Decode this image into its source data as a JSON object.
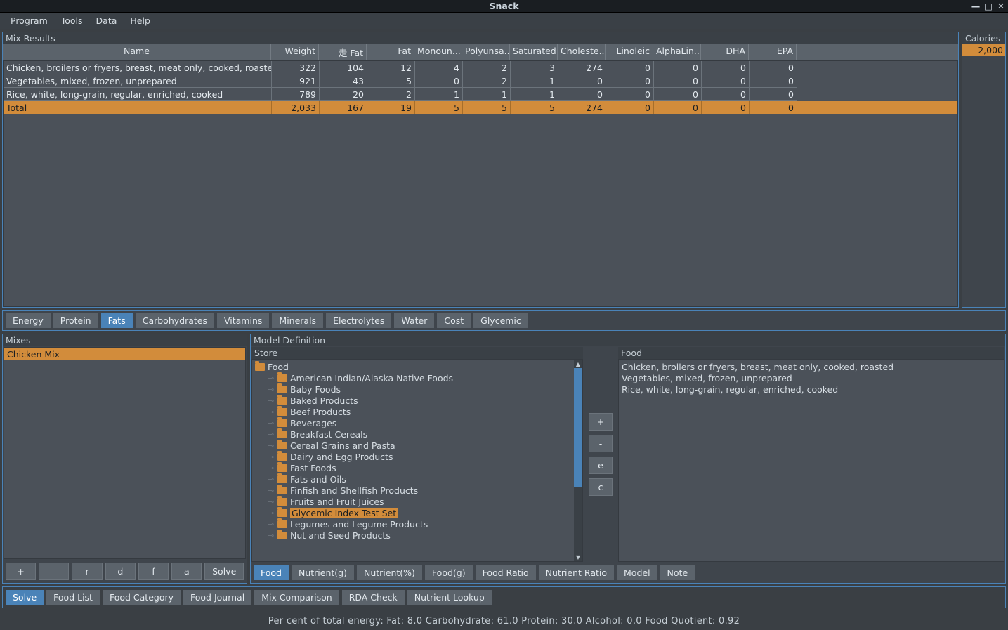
{
  "window": {
    "title": "Snack"
  },
  "menubar": {
    "items": [
      "Program",
      "Tools",
      "Data",
      "Help"
    ]
  },
  "calories": {
    "label": "Calories",
    "value": "2,000"
  },
  "mix_results": {
    "label": "Mix Results",
    "columns": [
      "Name",
      "Weight",
      "走 Fat",
      "Fat",
      "Monoun...",
      "Polyunsa...",
      "Saturated",
      "Choleste...",
      "Linoleic",
      "AlphaLin...",
      "DHA",
      "EPA"
    ],
    "rows": [
      {
        "name": "Chicken, broilers or fryers, breast, meat only, cooked, roasted",
        "vals": [
          "322",
          "104",
          "12",
          "4",
          "2",
          "3",
          "274",
          "0",
          "0",
          "0",
          "0"
        ]
      },
      {
        "name": "Vegetables, mixed, frozen, unprepared",
        "vals": [
          "921",
          "43",
          "5",
          "0",
          "2",
          "1",
          "0",
          "0",
          "0",
          "0",
          "0"
        ]
      },
      {
        "name": "Rice, white, long-grain, regular, enriched, cooked",
        "vals": [
          "789",
          "20",
          "2",
          "1",
          "1",
          "1",
          "0",
          "0",
          "0",
          "0",
          "0"
        ]
      }
    ],
    "total": {
      "name": "Total",
      "vals": [
        "2,033",
        "167",
        "19",
        "5",
        "5",
        "5",
        "274",
        "0",
        "0",
        "0",
        "0"
      ]
    }
  },
  "nutrient_tabs": {
    "items": [
      "Energy",
      "Protein",
      "Fats",
      "Carbohydrates",
      "Vitamins",
      "Minerals",
      "Electrolytes",
      "Water",
      "Cost",
      "Glycemic"
    ],
    "active": 2
  },
  "mixes": {
    "label": "Mixes",
    "items": [
      "Chicken Mix"
    ],
    "buttons": [
      "+",
      "-",
      "r",
      "d",
      "f",
      "a",
      "Solve"
    ]
  },
  "model_def": {
    "label": "Model Definition"
  },
  "store": {
    "label": "Store",
    "root": "Food",
    "children": [
      "American Indian/Alaska Native Foods",
      "Baby Foods",
      "Baked Products",
      "Beef Products",
      "Beverages",
      "Breakfast Cereals",
      "Cereal Grains and Pasta",
      "Dairy and Egg Products",
      "Fast Foods",
      "Fats and Oils",
      "Finfish and Shellfish Products",
      "Fruits and Fruit Juices",
      "Glycemic Index Test Set",
      "Legumes and Legume Products",
      "Nut and Seed Products"
    ],
    "selected": 12
  },
  "mid_buttons": [
    "+",
    "-",
    "e",
    "c"
  ],
  "food": {
    "label": "Food",
    "items": [
      "Chicken, broilers or fryers, breast, meat only, cooked, roasted",
      "Vegetables, mixed, frozen, unprepared",
      "Rice, white, long-grain, regular, enriched, cooked"
    ]
  },
  "model_tabs": {
    "items": [
      "Food",
      "Nutrient(g)",
      "Nutrient(%)",
      "Food(g)",
      "Food Ratio",
      "Nutrient Ratio",
      "Model",
      "Note"
    ],
    "active": 0
  },
  "nav_tabs": {
    "items": [
      "Solve",
      "Food List",
      "Food Category",
      "Food Journal",
      "Mix Comparison",
      "RDA Check",
      "Nutrient Lookup"
    ],
    "active": 0
  },
  "statusbar": "Per cent of total energy:    Fat: 8.0   Carbohydrate: 61.0   Protein: 30.0   Alcohol: 0.0     Food Quotient: 0.92"
}
